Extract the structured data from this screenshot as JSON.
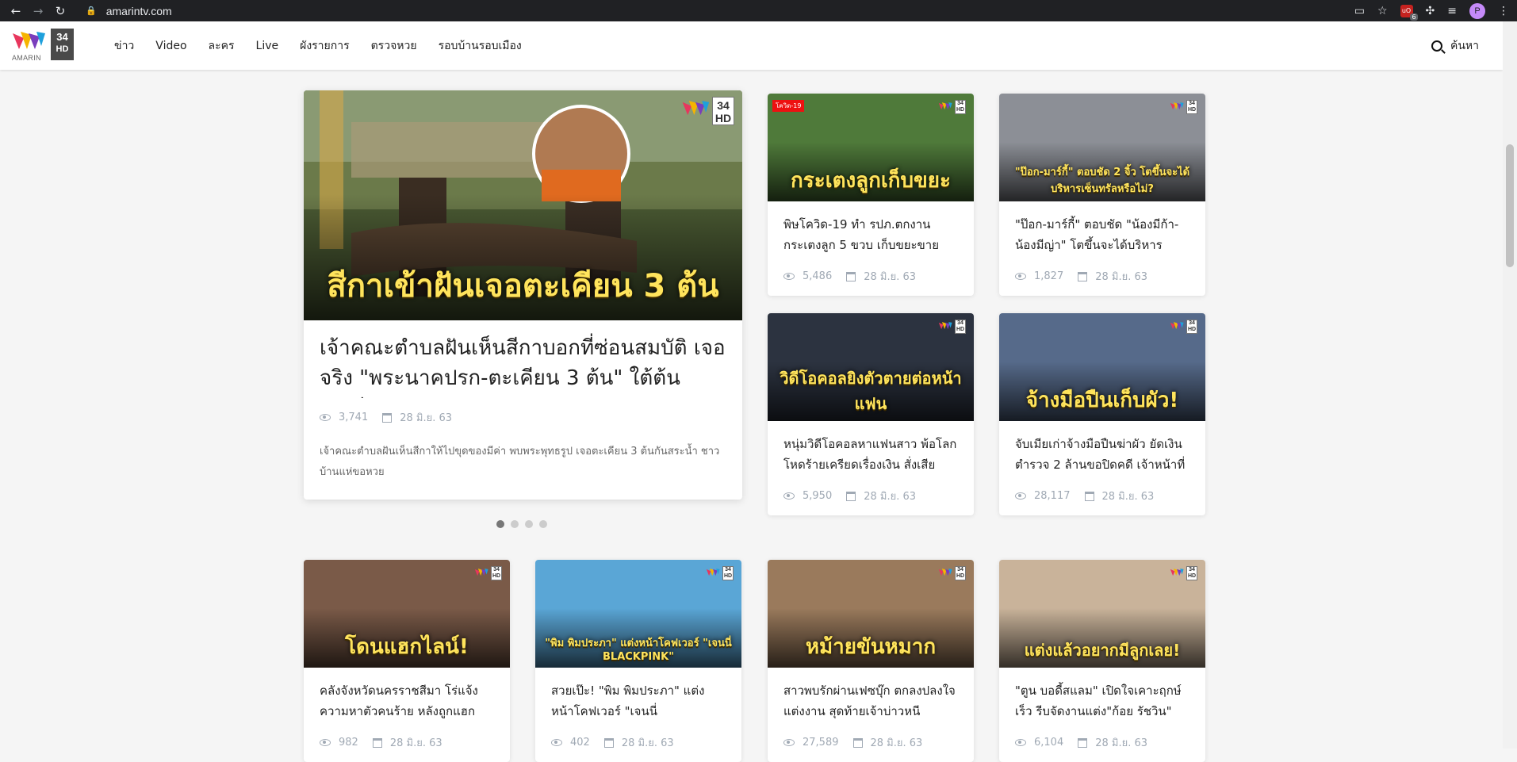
{
  "browser": {
    "url": "amarintv.com",
    "extension_badge": "6",
    "profile_initial": "P"
  },
  "header": {
    "logo_text": "AMARIN",
    "channel_num": "34",
    "channel_hd": "HD",
    "menu": [
      "ข่าว",
      "Video",
      "ละคร",
      "Live",
      "ผังรายการ",
      "ตรวจหวย",
      "รอบบ้านรอบเมือง"
    ],
    "search_label": "ค้นหา"
  },
  "watermark": {
    "num": "34",
    "hd": "HD"
  },
  "featured": {
    "image_caption": "สีกาเข้าฝันเจอตะเคียน 3 ต้น",
    "title": "เจ้าคณะตำบลฝันเห็นสีกาบอกที่ซ่อนสมบัติ เจอจริง \"พระนาคปรก-ตะเคียน 3 ต้น\" ใต้ต้นตะเคียน",
    "views": "3,741",
    "date": "28 มิ.ย. 63",
    "description": "เจ้าคณะตำบลฝันเห็นสีกาให้ไปขุดของมีค่า พบพระพุทธรูป เจอตะเคียน 3 ต้นกันสระน้ำ ชาวบ้านแห่ขอหวย"
  },
  "carousel_dots": 4,
  "cards": [
    {
      "tag": "โควิด-19",
      "caption": "กระเตงลูกเก็บขยะ",
      "title": "พิษโควิด-19 ทำ รปภ.ตกงาน กระเตงลูก 5 ขวบ เก็บขยะขาย",
      "views": "5,486",
      "date": "28 มิ.ย. 63",
      "bg": "#4f7a3a"
    },
    {
      "tag": "",
      "caption": "\"ป๊อก-มาร์กี้\" ตอบชัด 2 จิ้ว โตขึ้นจะได้บริหารเซ็นทรัลหรือไม่?",
      "title": "\"ป๊อก-มาร์กี้\" ตอบชัด \"น้องมีก้า-น้องมีญ่า\" โตขึ้นจะได้บริหาร",
      "views": "1,827",
      "date": "28 มิ.ย. 63",
      "bg": "#8c8f96"
    },
    {
      "tag": "",
      "caption": "วิดีโอคอลยิงตัวตายต่อหน้าแฟน",
      "title": "หนุ่มวิดีโอคอลหาแฟนสาว พ้อโลกโหดร้ายเครียดเรื่องเงิน สั่งเสีย",
      "views": "5,950",
      "date": "28 มิ.ย. 63",
      "bg": "#2c3340"
    },
    {
      "tag": "",
      "caption": "จ้างมือปืนเก็บผัว!",
      "title": "จับเมียเก่าจ้างมือปืนฆ่าผัว ยัดเงินตำรวจ 2 ล้านขอปิดคดี เจ้าหน้าที่",
      "views": "28,117",
      "date": "28 มิ.ย. 63",
      "bg": "#566a8a"
    },
    {
      "tag": "",
      "caption": "โดนแฮกไลน์!",
      "title": "คลังจังหวัดนครราชสีมา โร่แจ้งความหาตัวคนร้าย หลังถูกแฮก",
      "views": "982",
      "date": "28 มิ.ย. 63",
      "bg": "#7a5a48"
    },
    {
      "tag": "",
      "caption": "\"พิม พิมประภา\" แต่งหน้าโคฟเวอร์ \"เจนนี่ BLACKPINK\"",
      "title": "สวยเป๊ะ! \"พิม พิมประภา\" แต่งหน้าโคฟเวอร์ \"เจนนี่ BLACKPINK\"",
      "views": "402",
      "date": "28 มิ.ย. 63",
      "bg": "#5aa6d6"
    },
    {
      "tag": "",
      "caption": "หม้ายขันหมาก",
      "title": "สาวพบรักผ่านเฟซบุ๊ก ตกลงปลงใจแต่งงาน สุดท้ายเจ้าบ่าวหนี",
      "views": "27,589",
      "date": "28 มิ.ย. 63",
      "bg": "#9a7a5c"
    },
    {
      "tag": "",
      "caption": "แต่งแล้วอยากมีลูกเลย!",
      "title": "\"ตูน บอดี้สแลม\" เปิดใจเคาะฤกษ์เร็ว รีบจัดงานแต่ง\"ก้อย รัชวิน\"",
      "views": "6,104",
      "date": "28 มิ.ย. 63",
      "bg": "#c9b39a"
    }
  ],
  "colors": {
    "caption_yellow": "#ffe45c",
    "meta_gray": "#a0a9b4",
    "tag_red": "#ee1111"
  }
}
